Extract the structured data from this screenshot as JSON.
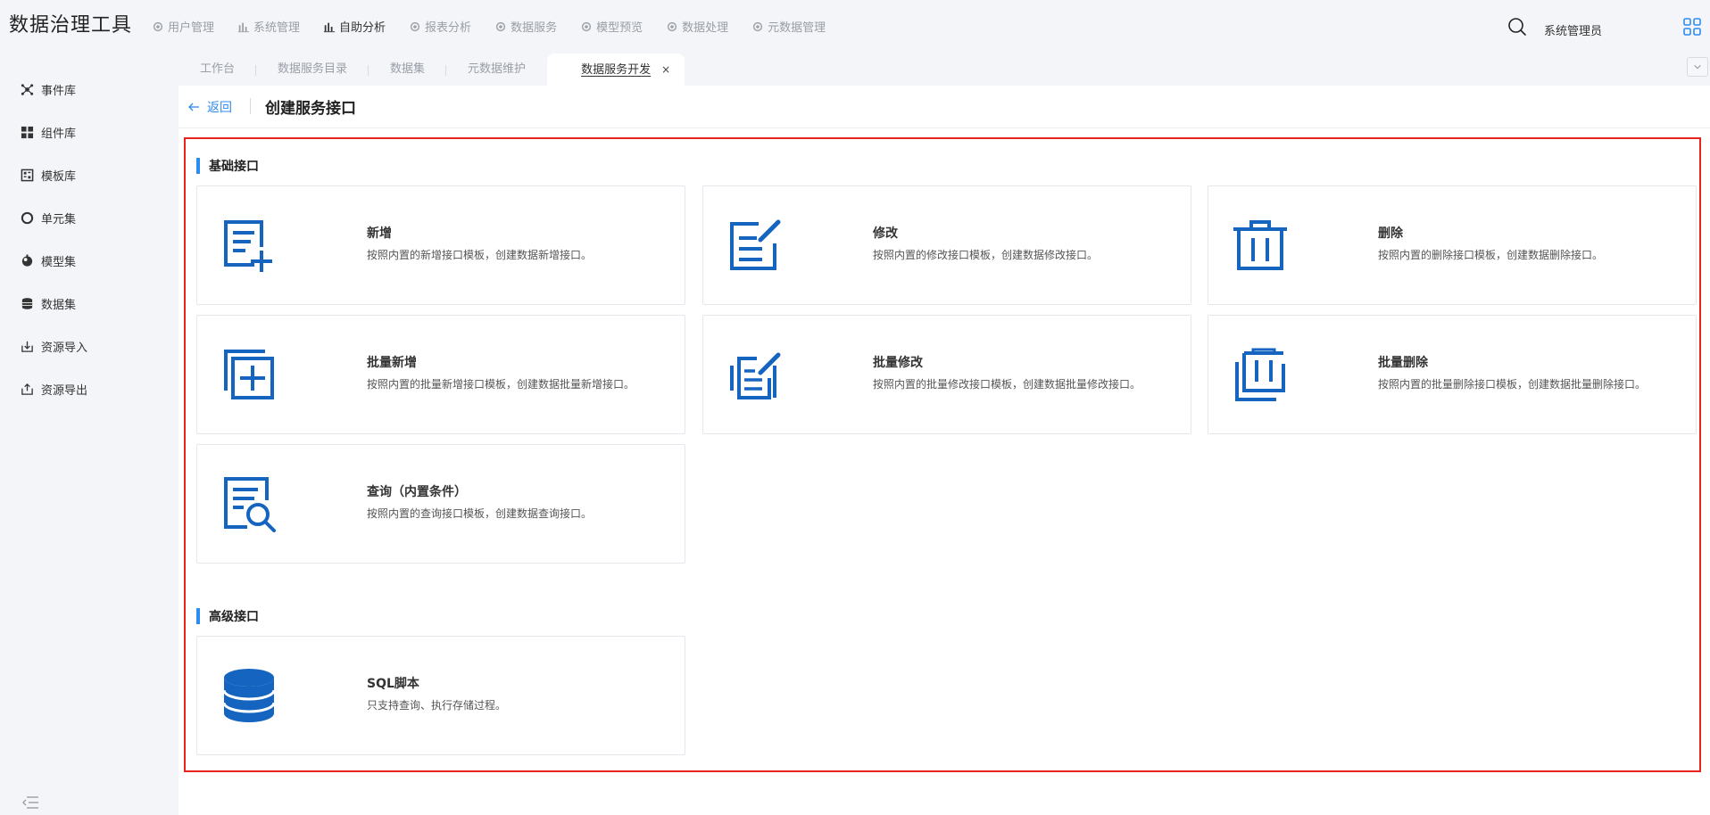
{
  "app": {
    "title": "数据治理工具"
  },
  "topnav": [
    {
      "label": "用户管理",
      "icon": "gear-icon"
    },
    {
      "label": "系统管理",
      "icon": "bar-chart-icon"
    },
    {
      "label": "自助分析",
      "icon": "bar-chart-icon",
      "active": true
    },
    {
      "label": "报表分析",
      "icon": "gear-icon"
    },
    {
      "label": "数据服务",
      "icon": "gear-icon"
    },
    {
      "label": "模型预览",
      "icon": "gear-icon"
    },
    {
      "label": "数据处理",
      "icon": "gear-icon"
    },
    {
      "label": "元数据管理",
      "icon": "gear-icon"
    }
  ],
  "user": {
    "name": "系统管理员"
  },
  "tabs": [
    {
      "label": "工作台"
    },
    {
      "label": "数据服务目录"
    },
    {
      "label": "数据集"
    },
    {
      "label": "元数据维护"
    },
    {
      "label": "数据服务开发",
      "active": true,
      "close": "×"
    }
  ],
  "sidebar": [
    {
      "label": "事件库",
      "icon": "network-icon"
    },
    {
      "label": "组件库",
      "icon": "grid-icon"
    },
    {
      "label": "模板库",
      "icon": "template-icon"
    },
    {
      "label": "单元集",
      "icon": "circle-icon"
    },
    {
      "label": "模型集",
      "icon": "model-icon"
    },
    {
      "label": "数据集",
      "icon": "database-icon"
    },
    {
      "label": "资源导入",
      "icon": "import-icon"
    },
    {
      "label": "资源导出",
      "icon": "export-icon"
    }
  ],
  "page": {
    "back_label": "返回",
    "title": "创建服务接口"
  },
  "sections": {
    "basic": "基础接口",
    "advanced": "高级接口"
  },
  "cards": [
    {
      "title": "新增",
      "desc": "按照内置的新增接口模板，创建数据新增接口。",
      "icon": "add-doc-icon"
    },
    {
      "title": "修改",
      "desc": "按照内置的修改接口模板，创建数据修改接口。",
      "icon": "edit-doc-icon"
    },
    {
      "title": "删除",
      "desc": "按照内置的删除接口模板，创建数据删除接口。",
      "icon": "trash-icon"
    },
    {
      "title": "批量新增",
      "desc": "按照内置的批量新增接口模板，创建数据批量新增接口。",
      "icon": "batch-add-icon"
    },
    {
      "title": "批量修改",
      "desc": "按照内置的批量修改接口模板，创建数据批量修改接口。",
      "icon": "batch-edit-icon"
    },
    {
      "title": "批量删除",
      "desc": "按照内置的批量删除接口模板，创建数据批量删除接口。",
      "icon": "batch-delete-icon"
    },
    {
      "title": "查询（内置条件）",
      "desc": "按照内置的查询接口模板，创建数据查询接口。",
      "icon": "search-doc-icon"
    },
    {
      "title": "SQL脚本",
      "desc": "只支持查询、执行存储过程。",
      "icon": "database-icon"
    }
  ],
  "colors": {
    "accent": "#2d8cf0",
    "icon_blue": "#1565c0",
    "highlight": "#e8231b"
  }
}
